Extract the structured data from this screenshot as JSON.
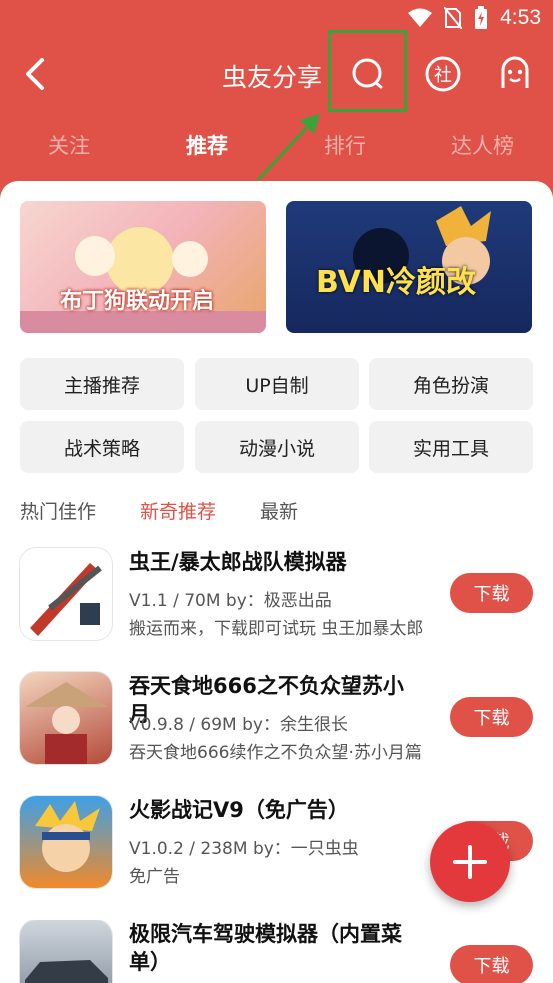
{
  "status": {
    "time": "4:53"
  },
  "header": {
    "title": "虫友分享"
  },
  "tabs": [
    "关注",
    "推荐",
    "排行",
    "达人榜"
  ],
  "banners": [
    {
      "label": "布丁狗联动开启"
    },
    {
      "label": "BVN冷颜改"
    }
  ],
  "categories": [
    "主播推荐",
    "UP自制",
    "角色扮演",
    "战术策略",
    "动漫小说",
    "实用工具"
  ],
  "filters": [
    "热门佳作",
    "新奇推荐",
    "最新"
  ],
  "apps": [
    {
      "name": "虫王/暴太郎战队模拟器",
      "meta": "V1.1 / 70M  by：极恶出品",
      "desc": "搬运而来，下载即可试玩 虫王加暴太郎",
      "download": "下载"
    },
    {
      "name": "吞天食地666之不负众望苏小月",
      "meta": "V0.9.8 / 69M  by：余生很长",
      "desc": "吞天食地666续作之不负众望·苏小月篇",
      "download": "下载"
    },
    {
      "name": "火影战记V9（免广告）",
      "meta": "V1.0.2 / 238M  by：一只虫虫",
      "desc": "免广告",
      "download": "下载"
    },
    {
      "name": "极限汽车驾驶模拟器（内置菜单）",
      "meta": "",
      "desc": "",
      "download": "下载"
    }
  ],
  "colors": {
    "primary": "#e05248",
    "highlight": "#3aa33a"
  }
}
